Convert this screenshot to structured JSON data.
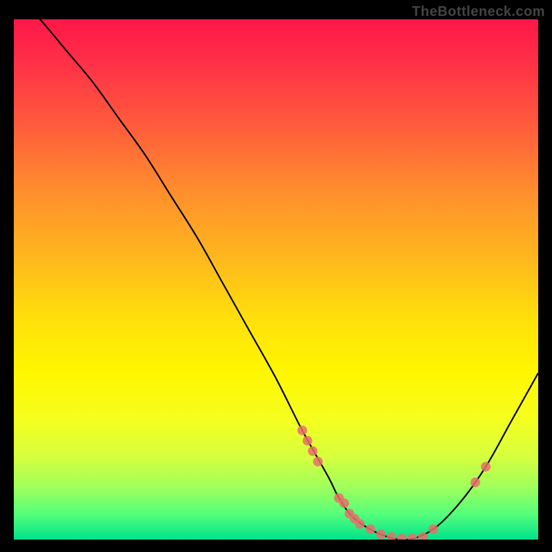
{
  "watermark": "TheBottleneck.com",
  "chart_data": {
    "type": "line",
    "title": "",
    "xlabel": "",
    "ylabel": "",
    "xlim": [
      0,
      100
    ],
    "ylim": [
      0,
      100
    ],
    "series": [
      {
        "name": "curve",
        "x": [
          0,
          5,
          10,
          15,
          20,
          25,
          30,
          35,
          40,
          45,
          50,
          55,
          60,
          62,
          65,
          70,
          75,
          80,
          85,
          90,
          95,
          100
        ],
        "y": [
          105,
          100,
          94,
          88,
          81,
          74,
          66,
          58,
          49,
          40,
          31,
          21,
          12,
          8,
          4,
          1,
          0,
          2,
          7,
          14,
          23,
          32
        ]
      }
    ],
    "markers": [
      {
        "x": 55,
        "y": 21
      },
      {
        "x": 56,
        "y": 19
      },
      {
        "x": 57,
        "y": 17
      },
      {
        "x": 58,
        "y": 15
      },
      {
        "x": 62,
        "y": 8
      },
      {
        "x": 63,
        "y": 7
      },
      {
        "x": 64,
        "y": 5
      },
      {
        "x": 65,
        "y": 4
      },
      {
        "x": 66,
        "y": 3
      },
      {
        "x": 68,
        "y": 2
      },
      {
        "x": 70,
        "y": 1
      },
      {
        "x": 72,
        "y": 0.5
      },
      {
        "x": 74,
        "y": 0.2
      },
      {
        "x": 76,
        "y": 0.2
      },
      {
        "x": 78,
        "y": 0.5
      },
      {
        "x": 80,
        "y": 2
      },
      {
        "x": 88,
        "y": 11
      },
      {
        "x": 90,
        "y": 14
      }
    ],
    "gradient_stops": [
      {
        "pos": 0.0,
        "color": "#ff1749"
      },
      {
        "pos": 0.5,
        "color": "#ffe10a"
      },
      {
        "pos": 1.0,
        "color": "#00e38b"
      }
    ]
  }
}
